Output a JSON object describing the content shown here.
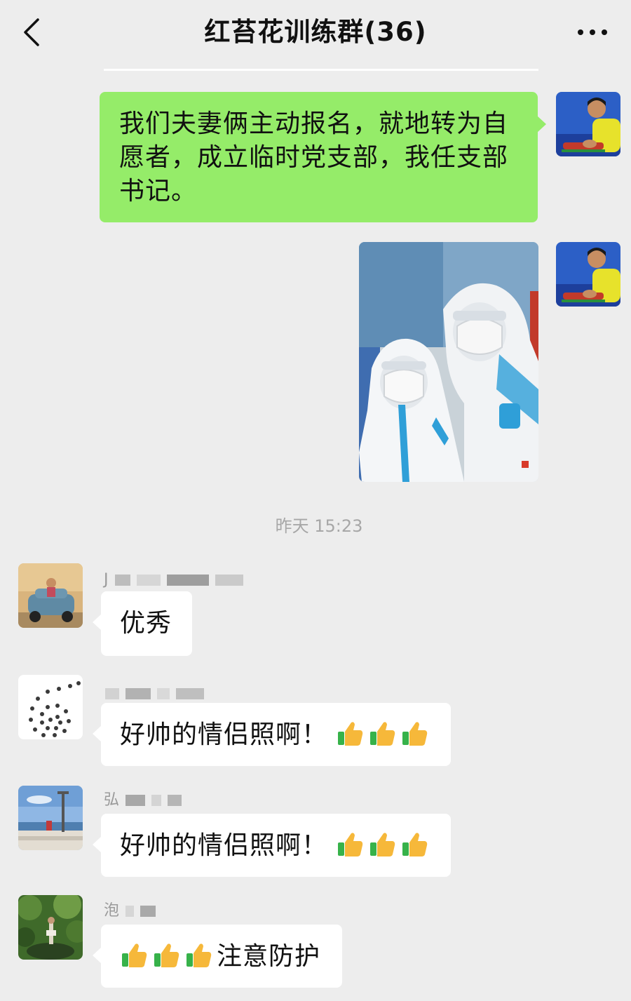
{
  "header": {
    "title": "红苔花训练群(36)",
    "back_icon": "chevron-left-icon",
    "more_icon": "more-dots-icon"
  },
  "messages": [
    {
      "direction": "outgoing",
      "type": "text",
      "lines": [
        "我们夫妻俩主动报名，就地转为自",
        "愿者，成立临时党支部，我任支部",
        "书记。"
      ]
    },
    {
      "direction": "outgoing",
      "type": "image"
    }
  ],
  "timestamp": "昨天 15:23",
  "incoming": [
    {
      "name_prefix": "J",
      "text": "优秀"
    },
    {
      "name_prefix": "",
      "text": "好帅的情侣照啊！"
    },
    {
      "name_prefix": "弘",
      "text": "好帅的情侣照啊！"
    },
    {
      "name_prefix": "泡",
      "text": "注意防护"
    }
  ],
  "colors": {
    "background": "#ededed",
    "outgoing_bubble": "#95ec69",
    "incoming_bubble": "#ffffff",
    "timestamp_text": "#a7a7a7"
  }
}
